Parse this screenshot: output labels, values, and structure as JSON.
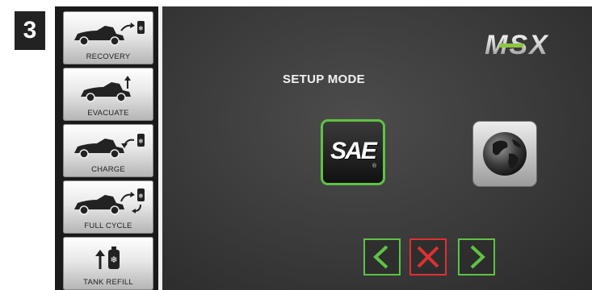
{
  "step_number": "3",
  "sidebar": {
    "items": [
      {
        "label": "RECOVERY",
        "icon": "car-recovery-icon"
      },
      {
        "label": "EVACUATE",
        "icon": "car-evacuate-icon"
      },
      {
        "label": "CHARGE",
        "icon": "car-charge-icon"
      },
      {
        "label": "FULL CYCLE",
        "icon": "car-full-cycle-icon"
      },
      {
        "label": "TANK REFILL",
        "icon": "tank-refill-icon"
      }
    ]
  },
  "brand": {
    "logo_text": "MSX",
    "accent_color": "#8cc63f"
  },
  "main": {
    "title": "SETUP MODE",
    "options": [
      {
        "label": "SAE",
        "mark": "®",
        "icon": "sae-icon",
        "selected": true
      },
      {
        "label": "",
        "icon": "globe-icon",
        "selected": false
      }
    ]
  },
  "nav": {
    "back_icon": "chevron-left-icon",
    "cancel_icon": "close-icon",
    "next_icon": "chevron-right-icon",
    "confirm_color": "#5fc243",
    "cancel_color": "#e03030"
  }
}
